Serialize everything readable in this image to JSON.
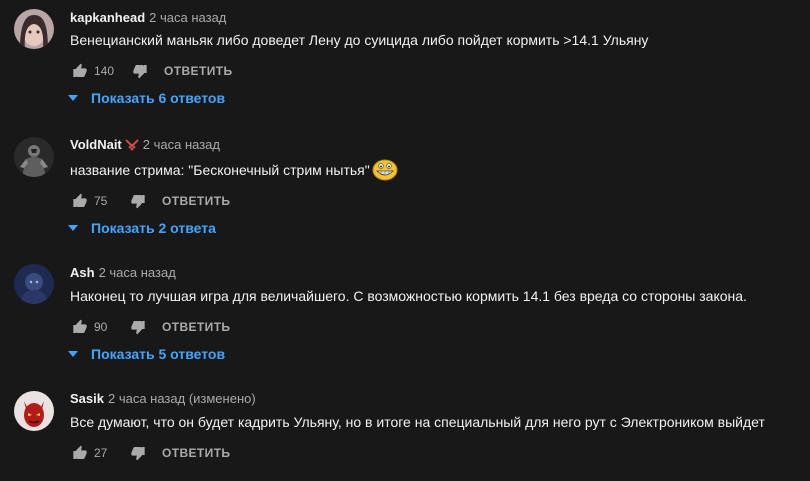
{
  "comments": [
    {
      "author": "kapkanhead",
      "time": "2 часа назад",
      "text": "Венецианский маньяк либо доведет Лену до суицида либо пойдет кормить >14.1 Ульяну",
      "likes": "140",
      "reply_label": "ОТВЕТИТЬ",
      "replies_label": "Показать 6 ответов",
      "avatar_icon": "girl-portrait-avatar"
    },
    {
      "author": "VoldNait",
      "time": "2 часа назад",
      "text": "название стрима: \"Бесконечный стрим нытья\"",
      "likes": "75",
      "reply_label": "ОТВЕТИТЬ",
      "replies_label": "Показать 2 ответа",
      "avatar_icon": "dark-warrior-avatar",
      "name_badge_icon": "sword-emoji-icon",
      "inline_emoji_icon": "grinning-face-emoji-icon"
    },
    {
      "author": "Ash",
      "time": "2 часа назад",
      "text": "Наконец то лучшая игра для величайшего. С возможностью кормить 14.1 без вреда со стороны закона.",
      "likes": "90",
      "reply_label": "ОТВЕТИТЬ",
      "replies_label": "Показать 5 ответов",
      "avatar_icon": "dark-figure-avatar"
    },
    {
      "author": "Sasik",
      "time": "2 часа назад (изменено)",
      "text": "Все думают, что он будет кадрить Ульяну, но в итоге на специальный для него рут с Электроником выйдет",
      "likes": "27",
      "reply_label": "ОТВЕТИТЬ",
      "avatar_icon": "red-demon-avatar"
    }
  ],
  "colors": {
    "background": "#181818",
    "text": "#f1f1f1",
    "secondary": "#aaaaaa",
    "link": "#3ea6ff"
  },
  "icons": {
    "like": "thumb-up-icon",
    "dislike": "thumb-down-icon",
    "expand": "chevron-down-icon"
  }
}
